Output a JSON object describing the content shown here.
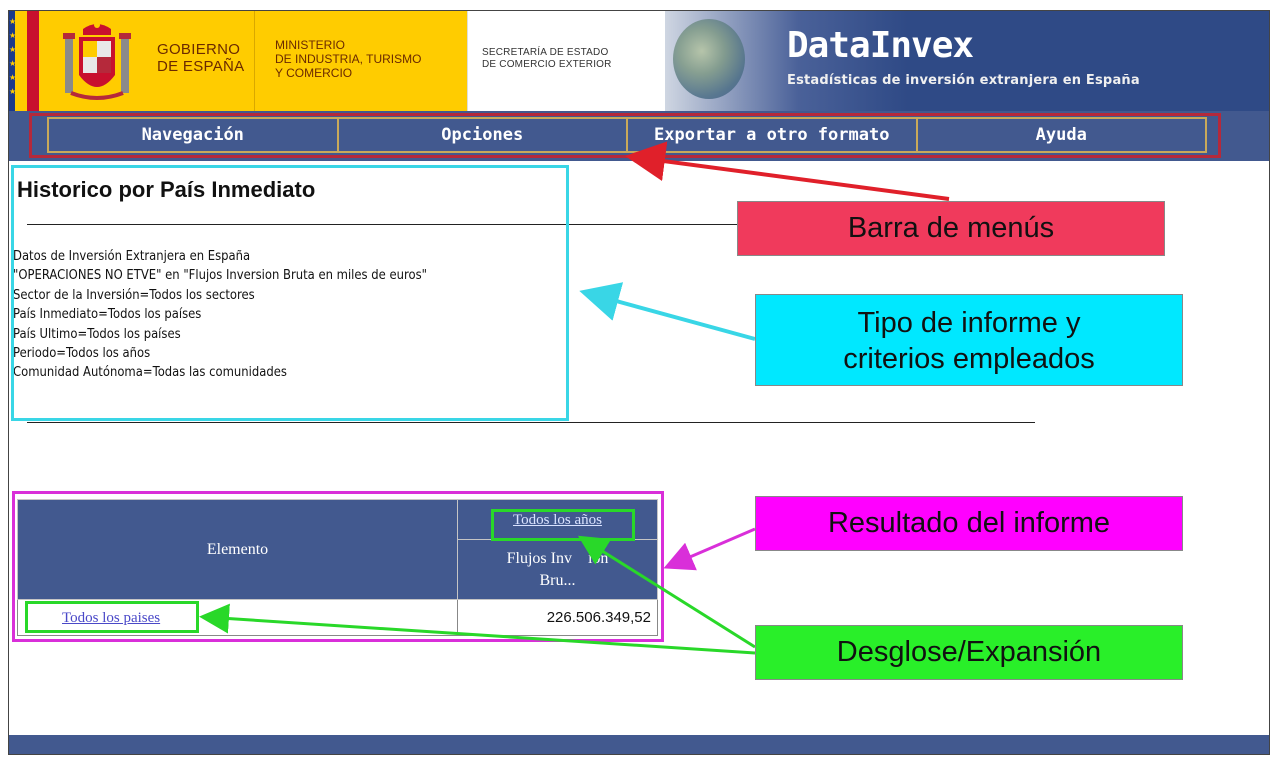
{
  "header": {
    "gobierno": [
      "GOBIERNO",
      "DE ESPAÑA"
    ],
    "ministerio": [
      "MINISTERIO",
      "DE INDUSTRIA, TURISMO",
      "Y COMERCIO"
    ],
    "secretaria": [
      "SECRETARÍA DE ESTADO",
      "DE COMERCIO EXTERIOR"
    ],
    "brand_title": "DataInvex",
    "brand_subtitle": "Estadísticas de inversión extranjera en España"
  },
  "menu": {
    "items": [
      "Navegación",
      "Opciones",
      "Exportar a otro formato",
      "Ayuda"
    ]
  },
  "report": {
    "title": "Historico por País Inmediato",
    "criteria": [
      "Datos de Inversión Extranjera en España",
      "\"OPERACIONES NO ETVE\" en \"Flujos Inversion Bruta en miles de euros\"",
      "Sector de la Inversión=Todos los sectores",
      "País Inmediato=Todos los países",
      "País Ultimo=Todos los países",
      "Periodo=Todos los años",
      "Comunidad Autónoma=Todas las comunidades"
    ]
  },
  "table": {
    "element_header": "Elemento",
    "years_link": "Todos los años",
    "flujos_header_line1": "Flujos Inv    ion",
    "flujos_header_line2": "Bru...",
    "row_link": "Todos los paises",
    "row_value": "226.506.349,52"
  },
  "callouts": {
    "menu_bar": "Barra de menús",
    "tipo_line1": "Tipo de informe y",
    "tipo_line2": "criterios empleados",
    "resultado": "Resultado del informe",
    "desglose": "Desglose/Expansión"
  },
  "colors": {
    "nav_blue": "#42598f",
    "gov_yellow": "#ffcc00",
    "menu_callout": "#f03a5c",
    "tipo_callout": "#00e8ff",
    "resultado_callout": "#ff00ff",
    "desglose_callout": "#29ef29"
  },
  "icons": [
    "spain-flag-icon",
    "coat-of-arms-icon",
    "globe-icon"
  ]
}
